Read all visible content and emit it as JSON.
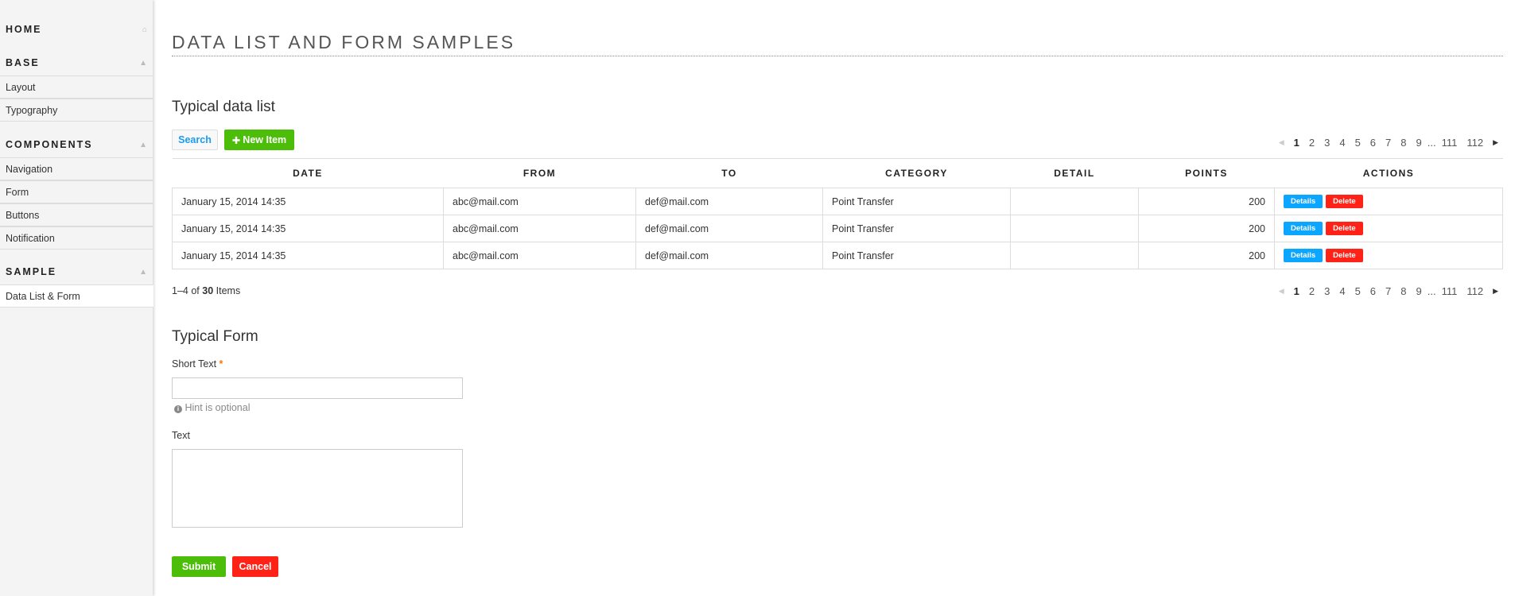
{
  "sidebar": {
    "home": "HOME",
    "sections": [
      {
        "label": "BASE",
        "items": [
          "Layout",
          "Typography"
        ]
      },
      {
        "label": "COMPONENTS",
        "items": [
          "Navigation",
          "Form",
          "Buttons",
          "Notification"
        ]
      },
      {
        "label": "SAMPLE",
        "items": [
          "Data List & Form"
        ]
      }
    ],
    "active_item": "Data List & Form"
  },
  "page": {
    "title": "DATA LIST AND FORM SAMPLES"
  },
  "list": {
    "heading": "Typical data list",
    "search_label": "Search",
    "new_item_label": "New Item",
    "pagination": [
      "1",
      "2",
      "3",
      "4",
      "5",
      "6",
      "7",
      "8",
      "9",
      "...",
      "111",
      "112"
    ],
    "current_page": "1",
    "columns": [
      "DATE",
      "FROM",
      "TO",
      "CATEGORY",
      "DETAIL",
      "POINTS",
      "ACTIONS"
    ],
    "rows": [
      {
        "date": "January 15, 2014 14:35",
        "from": "abc@mail.com",
        "to": "def@mail.com",
        "category": "Point Transfer",
        "detail": "",
        "points": "200"
      },
      {
        "date": "January 15, 2014 14:35",
        "from": "abc@mail.com",
        "to": "def@mail.com",
        "category": "Point Transfer",
        "detail": "",
        "points": "200"
      },
      {
        "date": "January 15, 2014 14:35",
        "from": "abc@mail.com",
        "to": "def@mail.com",
        "category": "Point Transfer",
        "detail": "",
        "points": "200"
      }
    ],
    "details_label": "Details",
    "delete_label": "Delete",
    "summary_prefix": "1–4 of",
    "summary_total": "30",
    "summary_suffix": "Items"
  },
  "form": {
    "heading": "Typical Form",
    "short_text_label": "Short Text",
    "required_mark": "*",
    "short_text_value": "",
    "hint": "Hint is optional",
    "text_label": "Text",
    "text_value": "",
    "submit_label": "Submit",
    "cancel_label": "Cancel"
  },
  "colors": {
    "green": "#4cbe0a",
    "red": "#ff2217",
    "blue": "#0aa6ff",
    "search_text": "#1a9cf0"
  }
}
